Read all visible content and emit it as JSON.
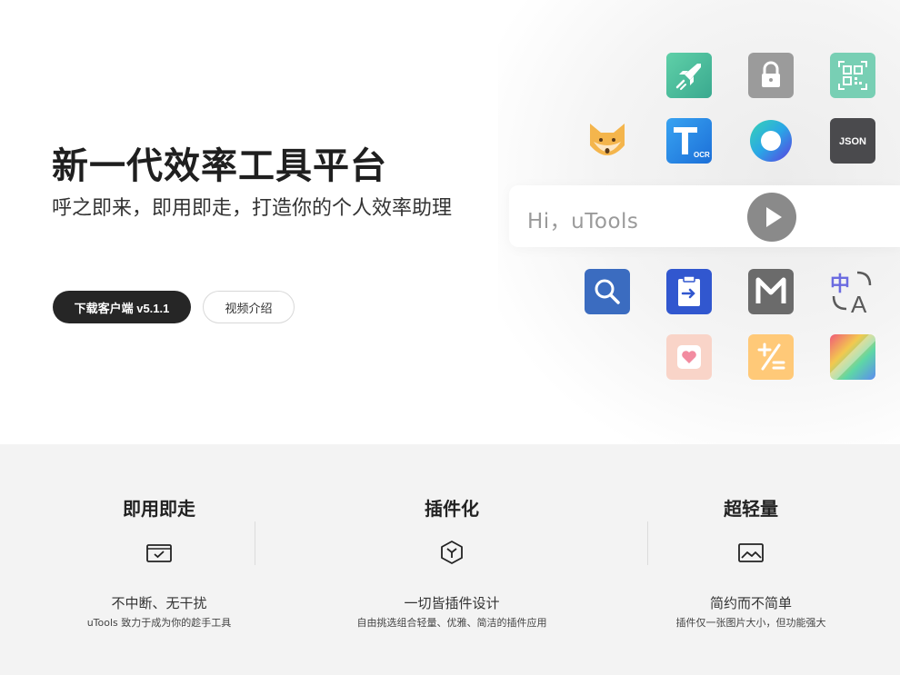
{
  "hero": {
    "title": "新一代效率工具平台",
    "subtitle": "呼之即来，即用即走，打造你的个人效率助理",
    "download_label": "下载客户端 v5.1.1",
    "video_label": "视频介绍",
    "search_placeholder": "Hi，uTools"
  },
  "apps": [
    {
      "name": "rocket-icon",
      "color": "#4fc3a1"
    },
    {
      "name": "lock-icon",
      "color": "#9e9e9e"
    },
    {
      "name": "qrcode-icon",
      "color": "#72cdb1"
    },
    {
      "name": "fox-icon",
      "color": "#f5b54a"
    },
    {
      "name": "ocr-icon",
      "color": "#2b8be6",
      "label": "OCR"
    },
    {
      "name": "browser-icon",
      "color": "#2ec7c9"
    },
    {
      "name": "json-icon",
      "color": "#4a4a4a",
      "label": "JSON"
    },
    {
      "name": "search-app-icon",
      "color": "#3d6fc0"
    },
    {
      "name": "clipboard-icon",
      "color": "#3358cc"
    },
    {
      "name": "markdown-icon",
      "color": "#6d6d6d"
    },
    {
      "name": "translate-icon",
      "color": "#6b6be0"
    },
    {
      "name": "sticker-icon",
      "color": "#f8d2c6"
    },
    {
      "name": "calculator-icon",
      "color": "#ffc876"
    },
    {
      "name": "color-picker-icon",
      "color": "#e86a8a"
    }
  ],
  "features": [
    {
      "title": "即用即走",
      "icon": "inbox-check-icon",
      "desc": "不中断、无干扰",
      "sub": "uTools 致力于成为你的趁手工具"
    },
    {
      "title": "插件化",
      "icon": "cube-icon",
      "desc": "一切皆插件设计",
      "sub": "自由挑选组合轻量、优雅、简洁的插件应用"
    },
    {
      "title": "超轻量",
      "icon": "image-icon",
      "desc": "简约而不简单",
      "sub": "插件仅一张图片大小，但功能强大"
    }
  ]
}
